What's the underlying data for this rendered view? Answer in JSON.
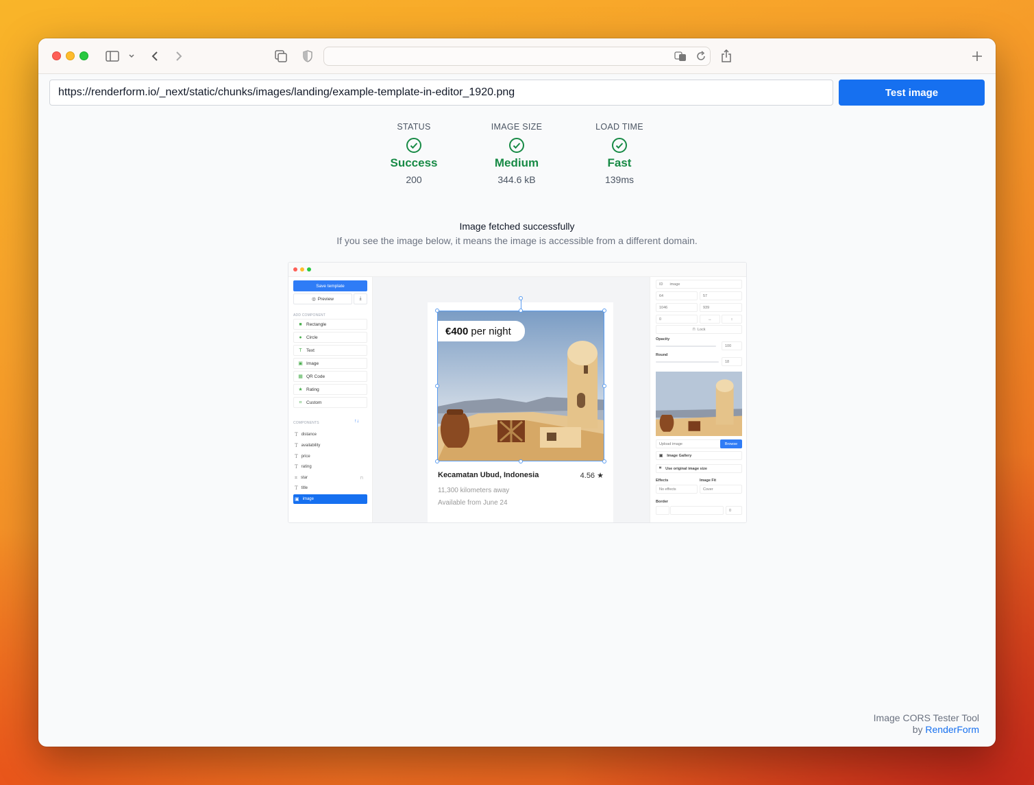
{
  "browser": {
    "address_text": ""
  },
  "form": {
    "url_value": "https://renderform.io/_next/static/chunks/images/landing/example-template-in-editor_1920.png",
    "test_button_label": "Test image"
  },
  "stats": [
    {
      "label": "STATUS",
      "value": "Success",
      "sub": "200"
    },
    {
      "label": "IMAGE SIZE",
      "value": "Medium",
      "sub": "344.6 kB"
    },
    {
      "label": "LOAD TIME",
      "value": "Fast",
      "sub": "139ms"
    }
  ],
  "colors": {
    "success": "#178a45",
    "accent": "#1670f0"
  },
  "message": {
    "title": "Image fetched successfully",
    "subtitle": "If you see the image below, it means the image is accessible from a different domain."
  },
  "preview": {
    "save_label": "Save template",
    "preview_label": "Preview",
    "add_component_label": "ADD COMPONENT",
    "components_add": [
      "Rectangle",
      "Circle",
      "Text",
      "Image",
      "QR Code",
      "Rating",
      "Custom"
    ],
    "components_label": "COMPONENTS",
    "layers": [
      "distance",
      "availability",
      "price",
      "rating",
      "star",
      "title",
      "image"
    ],
    "card": {
      "price_bold": "€400",
      "price_rest": "per night",
      "title": "Kecamatan Ubud, Indonesia",
      "rating": "4.56",
      "distance": "11,300 kilometers away",
      "availability": "Available from June 24"
    },
    "props": {
      "id_label": "ID",
      "id_value": "image",
      "x": "64",
      "y": "57",
      "w": "1046",
      "h": "939",
      "rotation": "0",
      "lock_label": "Lock",
      "opacity_label": "Opacity",
      "opacity_value": "100",
      "round_label": "Round",
      "round_value": "18",
      "upload_label": "Upload image",
      "browse_label": "Browse",
      "gallery_label": "Image Gallery",
      "original_size_label": "Use original image size",
      "effects_label": "Effects",
      "effects_value": "No effects",
      "fit_label": "Image Fit",
      "fit_value": "Cover",
      "border_label": "Border",
      "border_value": "0"
    }
  },
  "footer": {
    "line1": "Image CORS Tester Tool",
    "by": "by",
    "brand": "RenderForm"
  }
}
